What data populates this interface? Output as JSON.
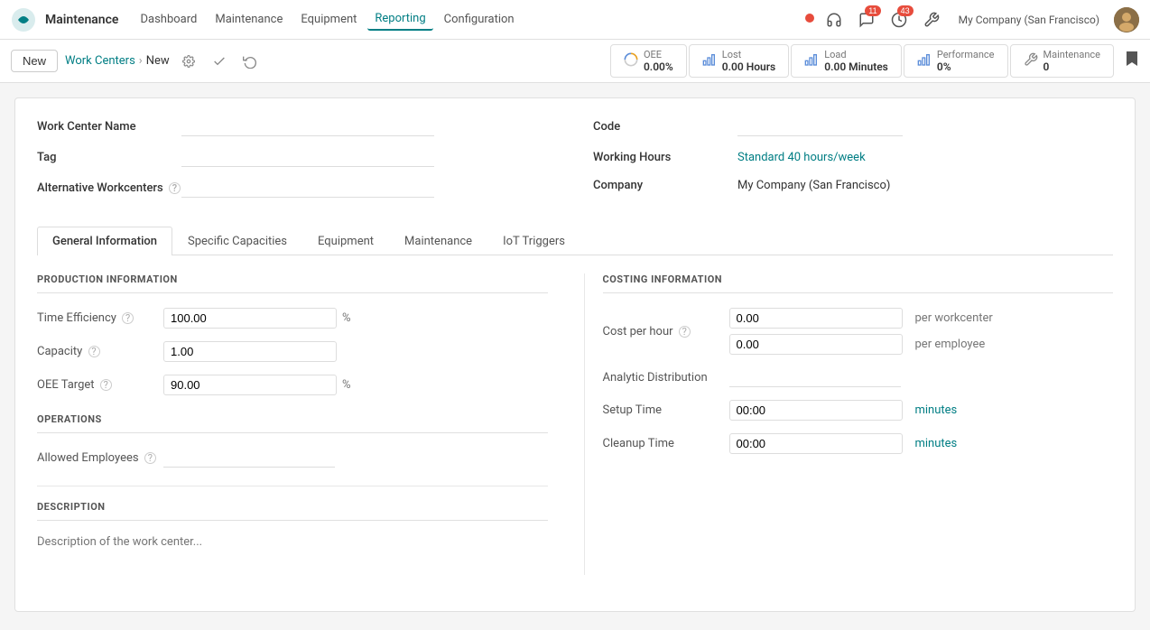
{
  "nav": {
    "app_name": "Maintenance",
    "links": [
      {
        "label": "Dashboard",
        "active": false
      },
      {
        "label": "Maintenance",
        "active": false
      },
      {
        "label": "Equipment",
        "active": false
      },
      {
        "label": "Reporting",
        "active": true
      },
      {
        "label": "Configuration",
        "active": false
      }
    ],
    "notifications": {
      "chat": 11,
      "activity": 43
    },
    "company": "My Company (San Francisco)"
  },
  "breadcrumb": {
    "parent": "Work Centers",
    "current": "New"
  },
  "toolbar": {
    "new_label": "New"
  },
  "stats": [
    {
      "id": "oee",
      "label": "OEE",
      "value": "0.00%",
      "icon": "pie"
    },
    {
      "id": "lost",
      "label": "Lost",
      "value": "0.00 Hours",
      "icon": "bar"
    },
    {
      "id": "load",
      "label": "Load",
      "value": "0.00 Minutes",
      "icon": "bar"
    },
    {
      "id": "performance",
      "label": "Performance",
      "value": "0%",
      "icon": "bar"
    },
    {
      "id": "maintenance",
      "label": "Maintenance",
      "value": "0",
      "icon": "wrench"
    }
  ],
  "form": {
    "work_center_name_label": "Work Center Name",
    "tag_label": "Tag",
    "alternative_workcenters_label": "Alternative Workcenters",
    "code_label": "Code",
    "working_hours_label": "Working Hours",
    "working_hours_value": "Standard 40 hours/week",
    "company_label": "Company",
    "company_value": "My Company (San Francisco)"
  },
  "tabs": [
    {
      "id": "general",
      "label": "General Information",
      "active": true
    },
    {
      "id": "capacities",
      "label": "Specific Capacities",
      "active": false
    },
    {
      "id": "equipment",
      "label": "Equipment",
      "active": false
    },
    {
      "id": "maintenance",
      "label": "Maintenance",
      "active": false
    },
    {
      "id": "iot",
      "label": "IoT Triggers",
      "active": false
    }
  ],
  "general_tab": {
    "production_section_title": "PRODUCTION INFORMATION",
    "costing_section_title": "COSTING INFORMATION",
    "operations_section_title": "OPERATIONS",
    "description_section_title": "DESCRIPTION",
    "fields": {
      "time_efficiency_label": "Time Efficiency",
      "time_efficiency_value": "100.00",
      "time_efficiency_unit": "%",
      "capacity_label": "Capacity",
      "capacity_value": "1.00",
      "oee_target_label": "OEE Target",
      "oee_target_value": "90.00",
      "oee_target_unit": "%",
      "cost_per_hour_label": "Cost per hour",
      "cost_per_hour_value1": "0.00",
      "cost_per_hour_unit1": "per workcenter",
      "cost_per_hour_value2": "0.00",
      "cost_per_hour_unit2": "per employee",
      "analytic_distribution_label": "Analytic Distribution",
      "setup_time_label": "Setup Time",
      "setup_time_value": "00:00",
      "setup_time_unit": "minutes",
      "cleanup_time_label": "Cleanup Time",
      "cleanup_time_value": "00:00",
      "cleanup_time_unit": "minutes",
      "allowed_employees_label": "Allowed Employees",
      "description_placeholder": "Description of the work center..."
    }
  }
}
